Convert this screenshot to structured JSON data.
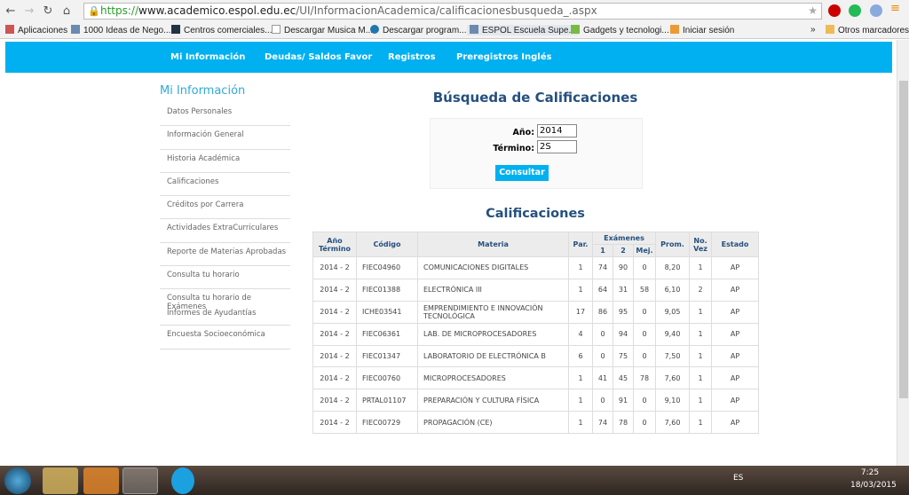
{
  "browser": {
    "url_scheme": "https://",
    "url_host": "www.academico.espol.edu.ec",
    "url_path": "/UI/InformacionAcademica/calificacionesbusqueda_.aspx",
    "bookmarks": [
      "Aplicaciones",
      "1000 Ideas de Nego...",
      "Centros comerciales...",
      "Descargar Musica M...",
      "Descargar program...",
      "ESPOL Escuela Supe...",
      "Gadgets y tecnologi...",
      "Iniciar sesión"
    ],
    "overflow": "»",
    "other_bookmarks": "Otros marcadores"
  },
  "topnav": [
    "Mi Información",
    "Deudas/ Saldos Favor",
    "Registros",
    "Preregistros Inglés"
  ],
  "sidebar": {
    "title": "Mi Información",
    "items": [
      "Datos Personales",
      "Información General",
      "Historia Académica",
      "Calificaciones",
      "Créditos por Carrera",
      "Actividades ExtraCurriculares",
      "Reporte de Materias Aprobadas",
      "Consulta tu horario",
      "Consulta tu horario de Exámenes",
      "Informes de Ayudantías",
      "Encuesta Socioeconómica"
    ]
  },
  "search": {
    "title": "Búsqueda de Calificaciones",
    "year_label": "Año:",
    "year_value": "2014",
    "term_label": "Término:",
    "term_value": "2S",
    "button": "Consultar"
  },
  "grades": {
    "title": "Calificaciones",
    "headers": {
      "term": "Año Término",
      "code": "Código",
      "subject": "Materia",
      "par": "Par.",
      "exams": "Exámenes",
      "e1": "1",
      "e2": "2",
      "mej": "Mej.",
      "avg": "Prom.",
      "times": "No. Vez",
      "status": "Estado"
    },
    "rows": [
      [
        "2014 - 2",
        "FIEC04960",
        "COMUNICACIONES DIGITALES",
        "1",
        "74",
        "90",
        "0",
        "8,20",
        "1",
        "AP"
      ],
      [
        "2014 - 2",
        "FIEC01388",
        "ELECTRÓNICA III",
        "1",
        "64",
        "31",
        "58",
        "6,10",
        "2",
        "AP"
      ],
      [
        "2014 - 2",
        "ICHE03541",
        "EMPRENDIMIENTO E INNOVACIÓN TECNOLÓGICA",
        "17",
        "86",
        "95",
        "0",
        "9,05",
        "1",
        "AP"
      ],
      [
        "2014 - 2",
        "FIEC06361",
        "LAB. DE MICROPROCESADORES",
        "4",
        "0",
        "94",
        "0",
        "9,40",
        "1",
        "AP"
      ],
      [
        "2014 - 2",
        "FIEC01347",
        "LABORATORIO DE ELECTRÓNICA B",
        "6",
        "0",
        "75",
        "0",
        "7,50",
        "1",
        "AP"
      ],
      [
        "2014 - 2",
        "FIEC00760",
        "MICROPROCESADORES",
        "1",
        "41",
        "45",
        "78",
        "7,60",
        "1",
        "AP"
      ],
      [
        "2014 - 2",
        "PRTAL01107",
        "PREPARACIÓN Y CULTURA FÍSICA",
        "1",
        "0",
        "91",
        "0",
        "9,10",
        "1",
        "AP"
      ],
      [
        "2014 - 2",
        "FIEC00729",
        "PROPAGACIÓN (CE)",
        "1",
        "74",
        "78",
        "0",
        "7,60",
        "1",
        "AP"
      ]
    ]
  },
  "taskbar": {
    "lang": "ES",
    "time": "7:25",
    "date": "18/03/2015"
  }
}
